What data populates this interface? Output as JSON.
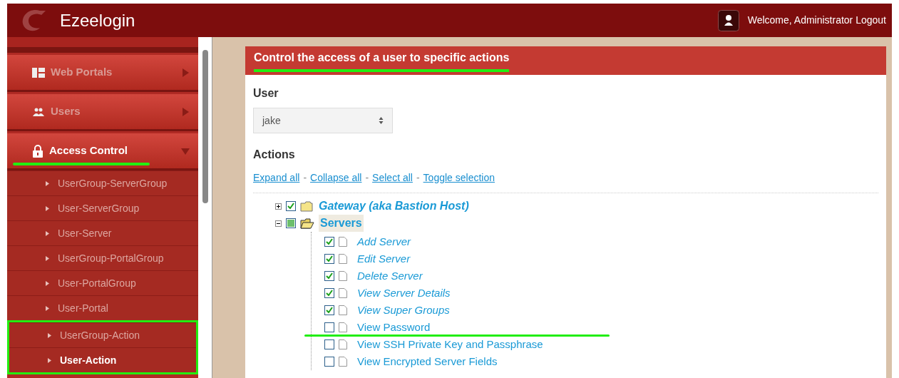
{
  "header": {
    "brand": "Ezeelogin",
    "welcome": "Welcome, Administrator Logout"
  },
  "sidebar": {
    "items": [
      {
        "kind": "main",
        "label": "Web Portals",
        "expanded": false,
        "selected": false,
        "highlighted": false
      },
      {
        "kind": "main",
        "label": "Users",
        "expanded": false,
        "selected": false,
        "highlighted": false
      },
      {
        "kind": "main",
        "label": "Access Control",
        "expanded": true,
        "selected": true,
        "highlighted": true
      },
      {
        "kind": "sub",
        "label": "UserGroup-ServerGroup",
        "selected": false,
        "framed": false
      },
      {
        "kind": "sub",
        "label": "User-ServerGroup",
        "selected": false,
        "framed": false
      },
      {
        "kind": "sub",
        "label": "User-Server",
        "selected": false,
        "framed": false
      },
      {
        "kind": "sub",
        "label": "UserGroup-PortalGroup",
        "selected": false,
        "framed": false
      },
      {
        "kind": "sub",
        "label": "User-PortalGroup",
        "selected": false,
        "framed": false
      },
      {
        "kind": "sub",
        "label": "User-Portal",
        "selected": false,
        "framed": false
      },
      {
        "kind": "sub",
        "label": "UserGroup-Action",
        "selected": false,
        "framed": true
      },
      {
        "kind": "sub",
        "label": "User-Action",
        "selected": true,
        "framed": true
      }
    ]
  },
  "panel": {
    "title": "Control the access of a user to specific actions",
    "title_highlighted": true,
    "user_label": "User",
    "user_value": "jake",
    "actions_label": "Actions",
    "links": [
      "Expand all",
      "Collapse all",
      "Select all",
      "Toggle selection"
    ],
    "links_separator": "-",
    "tree": [
      {
        "label": "Gateway (aka Bastion Host)",
        "checked": true,
        "expanded": false
      },
      {
        "label": "Servers",
        "checked": false,
        "partial": true,
        "expanded": true,
        "children": [
          {
            "label": "Add Server",
            "checked": true,
            "highlighted": false
          },
          {
            "label": "Edit Server",
            "checked": true,
            "highlighted": false
          },
          {
            "label": "Delete Server",
            "checked": true,
            "highlighted": false
          },
          {
            "label": "View Server Details",
            "checked": true,
            "highlighted": false
          },
          {
            "label": "View Super Groups",
            "checked": true,
            "highlighted": false
          },
          {
            "label": "View Password",
            "checked": false,
            "highlighted": true
          },
          {
            "label": "View SSH Private Key and Passphrase",
            "checked": false,
            "highlighted": false
          },
          {
            "label": "View Encrypted Server Fields",
            "checked": false,
            "highlighted": false
          }
        ]
      }
    ]
  }
}
